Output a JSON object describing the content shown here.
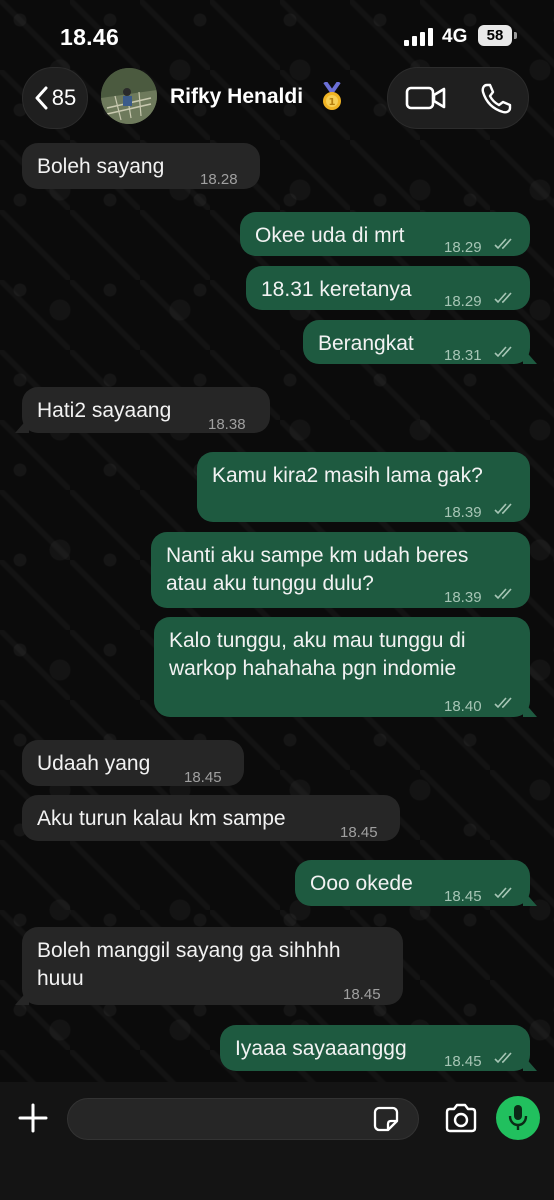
{
  "status_bar": {
    "time": "18.46",
    "network": "4G",
    "battery": "58"
  },
  "header": {
    "back_count": "85",
    "contact_name": "Rifky Henaldi"
  },
  "colors": {
    "outgoing_bubble": "#1e5a40",
    "incoming_bubble": "#262626",
    "mic_green": "#21c05e"
  },
  "messages": [
    {
      "direction": "in",
      "lines": [
        "Boleh sayang"
      ],
      "time": "18.28"
    },
    {
      "direction": "out",
      "lines": [
        "Okee uda di mrt"
      ],
      "time": "18.29"
    },
    {
      "direction": "out",
      "lines": [
        "18.31 keretanya"
      ],
      "time": "18.29"
    },
    {
      "direction": "out",
      "lines": [
        "Berangkat"
      ],
      "time": "18.31"
    },
    {
      "direction": "in",
      "lines": [
        "Hati2 sayaang"
      ],
      "time": "18.38"
    },
    {
      "direction": "out",
      "lines": [
        "Kamu kira2 masih lama gak?"
      ],
      "time": "18.39"
    },
    {
      "direction": "out",
      "lines": [
        "Nanti aku sampe km udah beres",
        "atau aku tunggu dulu?"
      ],
      "time": "18.39"
    },
    {
      "direction": "out",
      "lines": [
        "Kalo tunggu, aku mau tunggu di",
        "warkop hahahaha pgn indomie"
      ],
      "time": "18.40"
    },
    {
      "direction": "in",
      "lines": [
        "Udaah yang"
      ],
      "time": "18.45"
    },
    {
      "direction": "in",
      "lines": [
        "Aku turun kalau km sampe"
      ],
      "time": "18.45"
    },
    {
      "direction": "out",
      "lines": [
        "Ooo okede"
      ],
      "time": "18.45"
    },
    {
      "direction": "in",
      "lines": [
        "Boleh manggil sayang ga sihhhh",
        "huuu"
      ],
      "time": "18.45"
    },
    {
      "direction": "out",
      "lines": [
        "Iyaaa sayaaanggg"
      ],
      "time": "18.45"
    }
  ],
  "composer": {
    "placeholder": ""
  }
}
